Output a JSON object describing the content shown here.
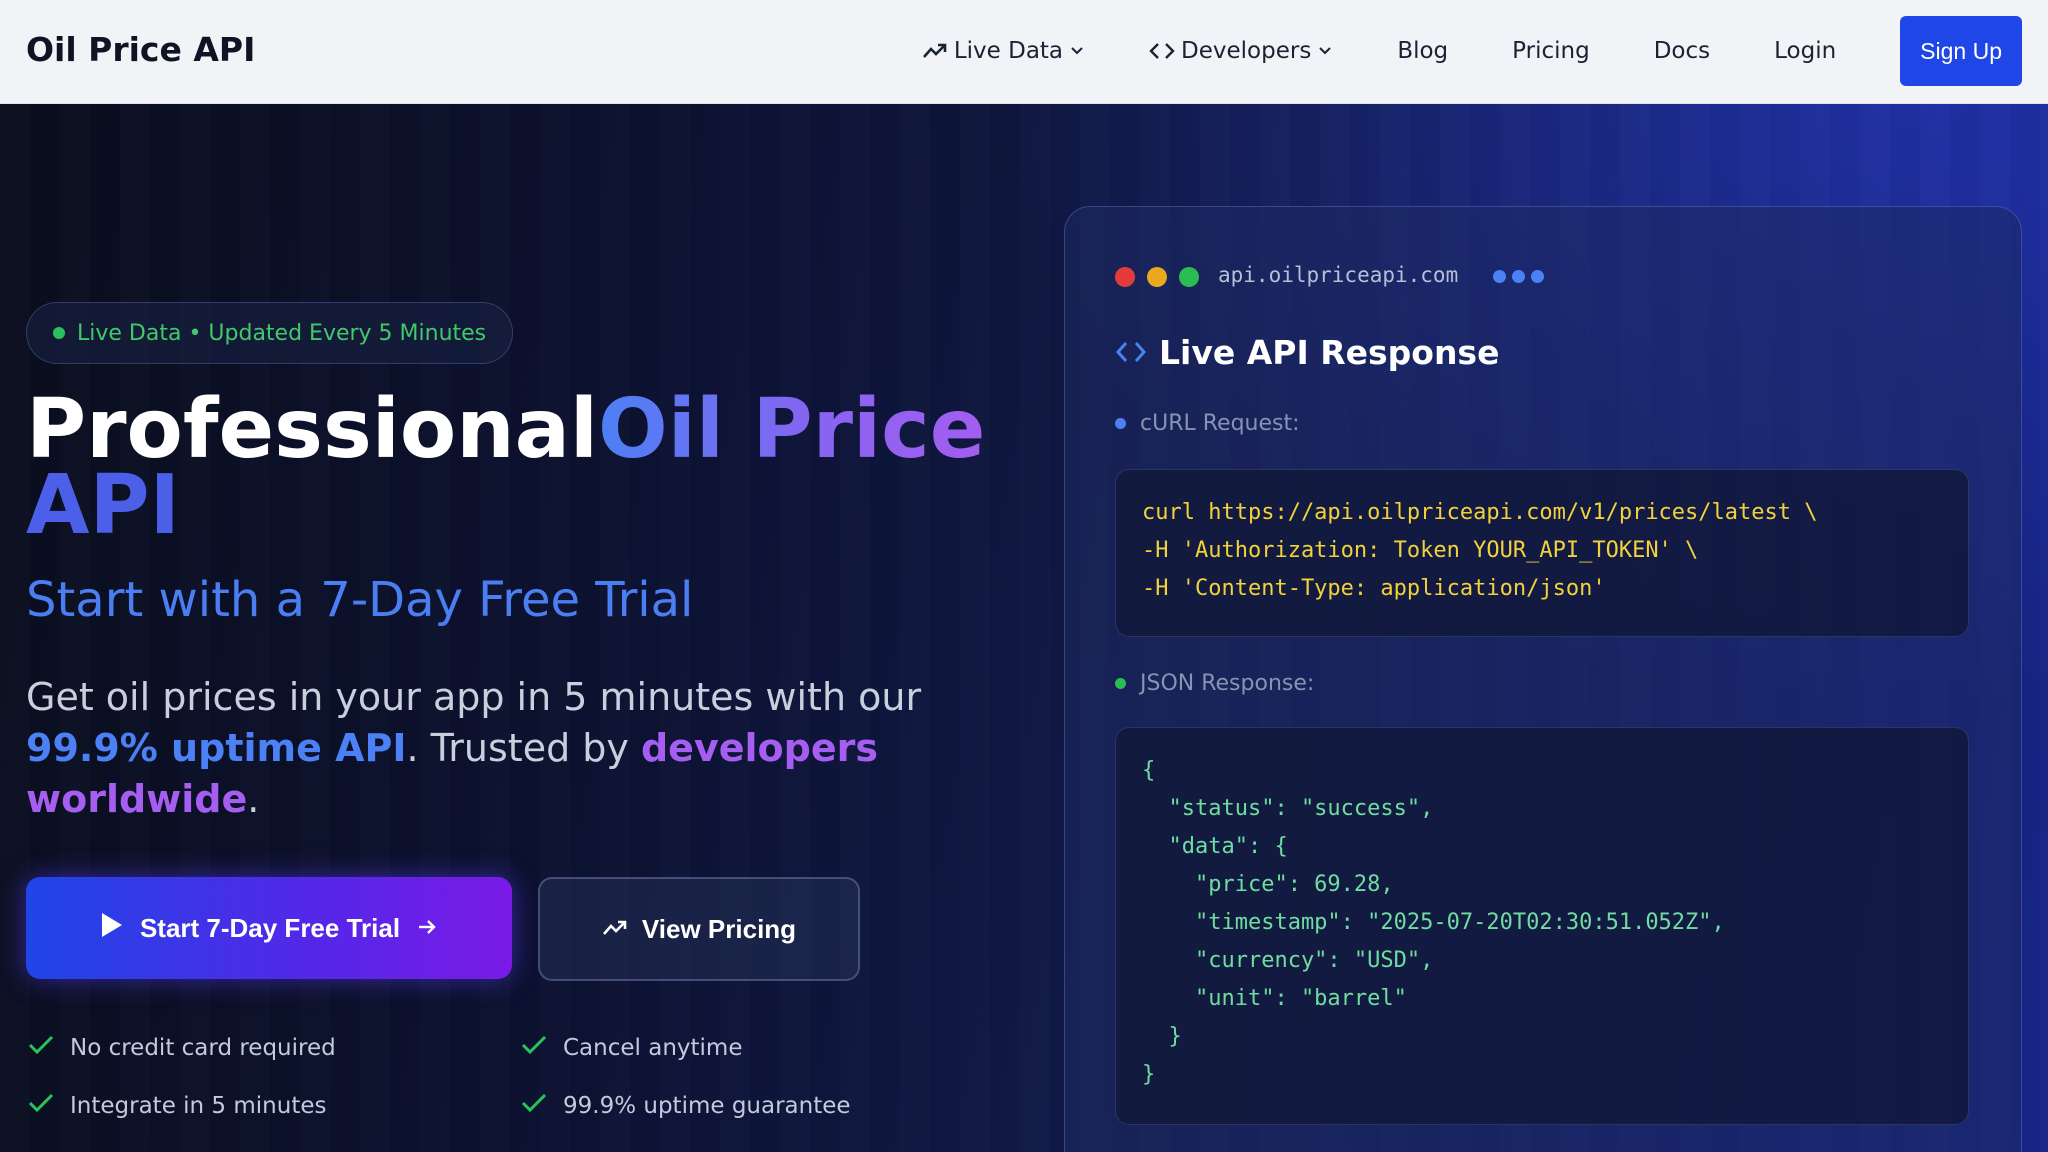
{
  "nav": {
    "brand": "Oil Price API",
    "items": [
      {
        "label": "Live Data"
      },
      {
        "label": "Developers"
      },
      {
        "label": "Blog"
      },
      {
        "label": "Pricing"
      },
      {
        "label": "Docs"
      },
      {
        "label": "Login"
      }
    ],
    "signup": "Sign Up"
  },
  "hero": {
    "badge": "Live Data • Updated Every 5 Minutes",
    "headline_1": "Professional",
    "headline_2": "Oil Price",
    "headline_3": "API",
    "subhead": "Start with a 7-Day Free Trial",
    "desc_1": "Get oil prices in your app in 5 minutes with our ",
    "desc_2": "99.9% uptime API",
    "desc_3": ". Trusted by ",
    "desc_4": "developers worldwide",
    "desc_5": ".",
    "cta_primary": "Start 7-Day Free Trial",
    "cta_secondary": "View Pricing",
    "features": [
      "No credit card required",
      "Cancel anytime",
      "Integrate in 5 minutes",
      "99.9% uptime guarantee"
    ]
  },
  "panel": {
    "url": "api.oilpriceapi.com",
    "title": "Live API Response",
    "curl_label": "cURL Request:",
    "curl_lines": [
      "curl https://api.oilpriceapi.com/v1/prices/latest \\",
      "-H 'Authorization: Token YOUR_API_TOKEN' \\",
      "-H 'Content-Type: application/json'"
    ],
    "json_label": "JSON Response:",
    "json_lines": [
      "{",
      "  \"status\": \"success\",",
      "  \"data\": {",
      "    \"price\": 69.28,",
      "    \"timestamp\": \"2025-07-20T02:30:51.052Z\",",
      "    \"currency\": \"USD\",",
      "    \"unit\": \"barrel\"",
      "  }",
      "}"
    ]
  },
  "colors": {
    "accent_blue": "#1f46e6",
    "live_green": "#2bc25c",
    "code_yellow": "#f2d13a",
    "code_green": "#6fdca0",
    "dot_red": "#e33b3b",
    "dot_yellow": "#e9a81e",
    "dot_green": "#2bbd52"
  }
}
